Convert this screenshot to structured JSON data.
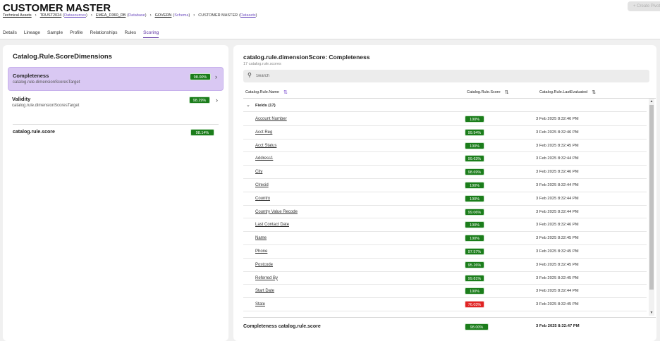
{
  "header": {
    "title": "CUSTOMER MASTER",
    "create_button": "+ Create Pivot"
  },
  "breadcrumb": {
    "technical_assets": "Technical Assets",
    "trust": "TRUST2024",
    "trust_type": "Datasources",
    "emea": "EMEA_D360_DB",
    "emea_type": "Database",
    "govern": "GOVERN",
    "govern_type": "Schema",
    "current": "CUSTOMER MASTER",
    "current_type": "Datasets"
  },
  "tabs": [
    "Details",
    "Lineage",
    "Sample",
    "Profile",
    "Relationships",
    "Rules",
    "Scoring"
  ],
  "left": {
    "title": "Catalog.Rule.ScoreDimensions",
    "dimensions": [
      {
        "name": "Completeness",
        "sub": "catalog.rule.dimensionScoresTarget",
        "score": "98.00%"
      },
      {
        "name": "Validity",
        "sub": "catalog.rule.dimensionScoresTarget",
        "score": "98.29%"
      }
    ],
    "score_label": "catalog.rule.score",
    "score_value": "98.14%"
  },
  "right": {
    "title": "catalog.rule.dimensionScore: Completeness",
    "subtitle": "17 catalog.rule.scores",
    "search_placeholder": "Search",
    "columns": {
      "name": "Catalog.Rule.Name",
      "score": "Catalog.Rule.Score",
      "evaluated": "Catalog.Rule.LastEvaluated"
    },
    "group_label": "Fields (17)",
    "rows": [
      {
        "name": "Account Number",
        "score": "100%",
        "date": "3 Feb 2025 8:32:46 PM",
        "status": "green"
      },
      {
        "name": "Acct Reg",
        "score": "99.94%",
        "date": "3 Feb 2025 8:32:46 PM",
        "status": "green"
      },
      {
        "name": "Acct Status",
        "score": "100%",
        "date": "3 Feb 2025 8:32:45 PM",
        "status": "green"
      },
      {
        "name": "Address1",
        "score": "99.63%",
        "date": "3 Feb 2025 8:32:44 PM",
        "status": "green"
      },
      {
        "name": "City",
        "score": "98.69%",
        "date": "3 Feb 2025 8:32:46 PM",
        "status": "green"
      },
      {
        "name": "Clrecid",
        "score": "100%",
        "date": "3 Feb 2025 8:32:44 PM",
        "status": "green"
      },
      {
        "name": "Country",
        "score": "100%",
        "date": "3 Feb 2025 8:32:44 PM",
        "status": "green"
      },
      {
        "name": "Country Value Recode",
        "score": "99.06%",
        "date": "3 Feb 2025 8:32:44 PM",
        "status": "green"
      },
      {
        "name": "Last Contact Date",
        "score": "100%",
        "date": "3 Feb 2025 8:32:46 PM",
        "status": "green"
      },
      {
        "name": "Name",
        "score": "100%",
        "date": "3 Feb 2025 8:32:45 PM",
        "status": "green"
      },
      {
        "name": "Phone",
        "score": "97.57%",
        "date": "3 Feb 2025 8:32:45 PM",
        "status": "green"
      },
      {
        "name": "Postcode",
        "score": "95.26%",
        "date": "3 Feb 2025 8:32:45 PM",
        "status": "green"
      },
      {
        "name": "Referred By",
        "score": "99.81%",
        "date": "3 Feb 2025 8:32:45 PM",
        "status": "green"
      },
      {
        "name": "Start Date",
        "score": "100%",
        "date": "3 Feb 2025 8:32:44 PM",
        "status": "green"
      },
      {
        "name": "State",
        "score": "76.03%",
        "date": "3 Feb 2025 8:32:45 PM",
        "status": "red"
      }
    ],
    "footer_label": "Completeness catalog.rule.score",
    "footer_score": "98.00%",
    "footer_date": "3 Feb 2025 8:32:47 PM"
  },
  "colors": {
    "accent": "#5a2ca0",
    "selected_bg": "#d9c8f3",
    "good": "#1b7d1b",
    "bad": "#e02323"
  }
}
